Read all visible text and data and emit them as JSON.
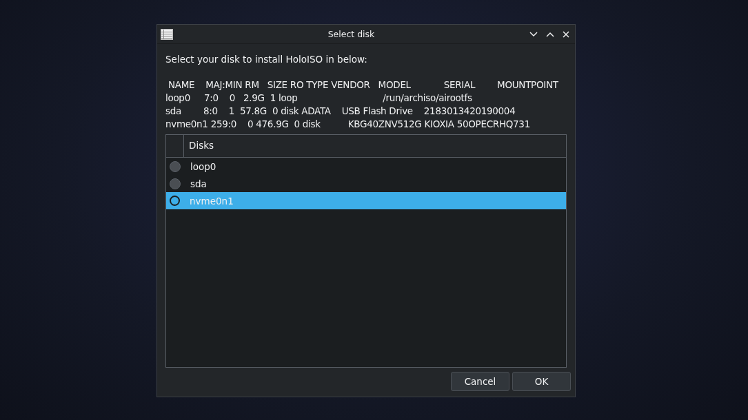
{
  "window": {
    "title": "Select disk"
  },
  "prompt": "Select your disk to install HoloISO in below:",
  "disk_listing": [
    " NAME    MAJ:MIN RM   SIZE RO TYPE VENDOR   MODEL            SERIAL        MOUNTPOINT",
    "loop0     7:0    0   2.9G  1 loop                               /run/archiso/airootfs",
    "sda        8:0    1  57.8G  0 disk ADATA    USB Flash Drive    2183013420190004",
    "nvme0n1 259:0    0 476.9G  0 disk          KBG40ZNV512G KIOXIA 50OPECRHQ731"
  ],
  "table": {
    "columns": [
      "Disks"
    ],
    "rows": [
      {
        "label": "loop0",
        "selected": false
      },
      {
        "label": "sda",
        "selected": false
      },
      {
        "label": "nvme0n1",
        "selected": true
      }
    ]
  },
  "buttons": [
    "Cancel",
    "OK"
  ]
}
